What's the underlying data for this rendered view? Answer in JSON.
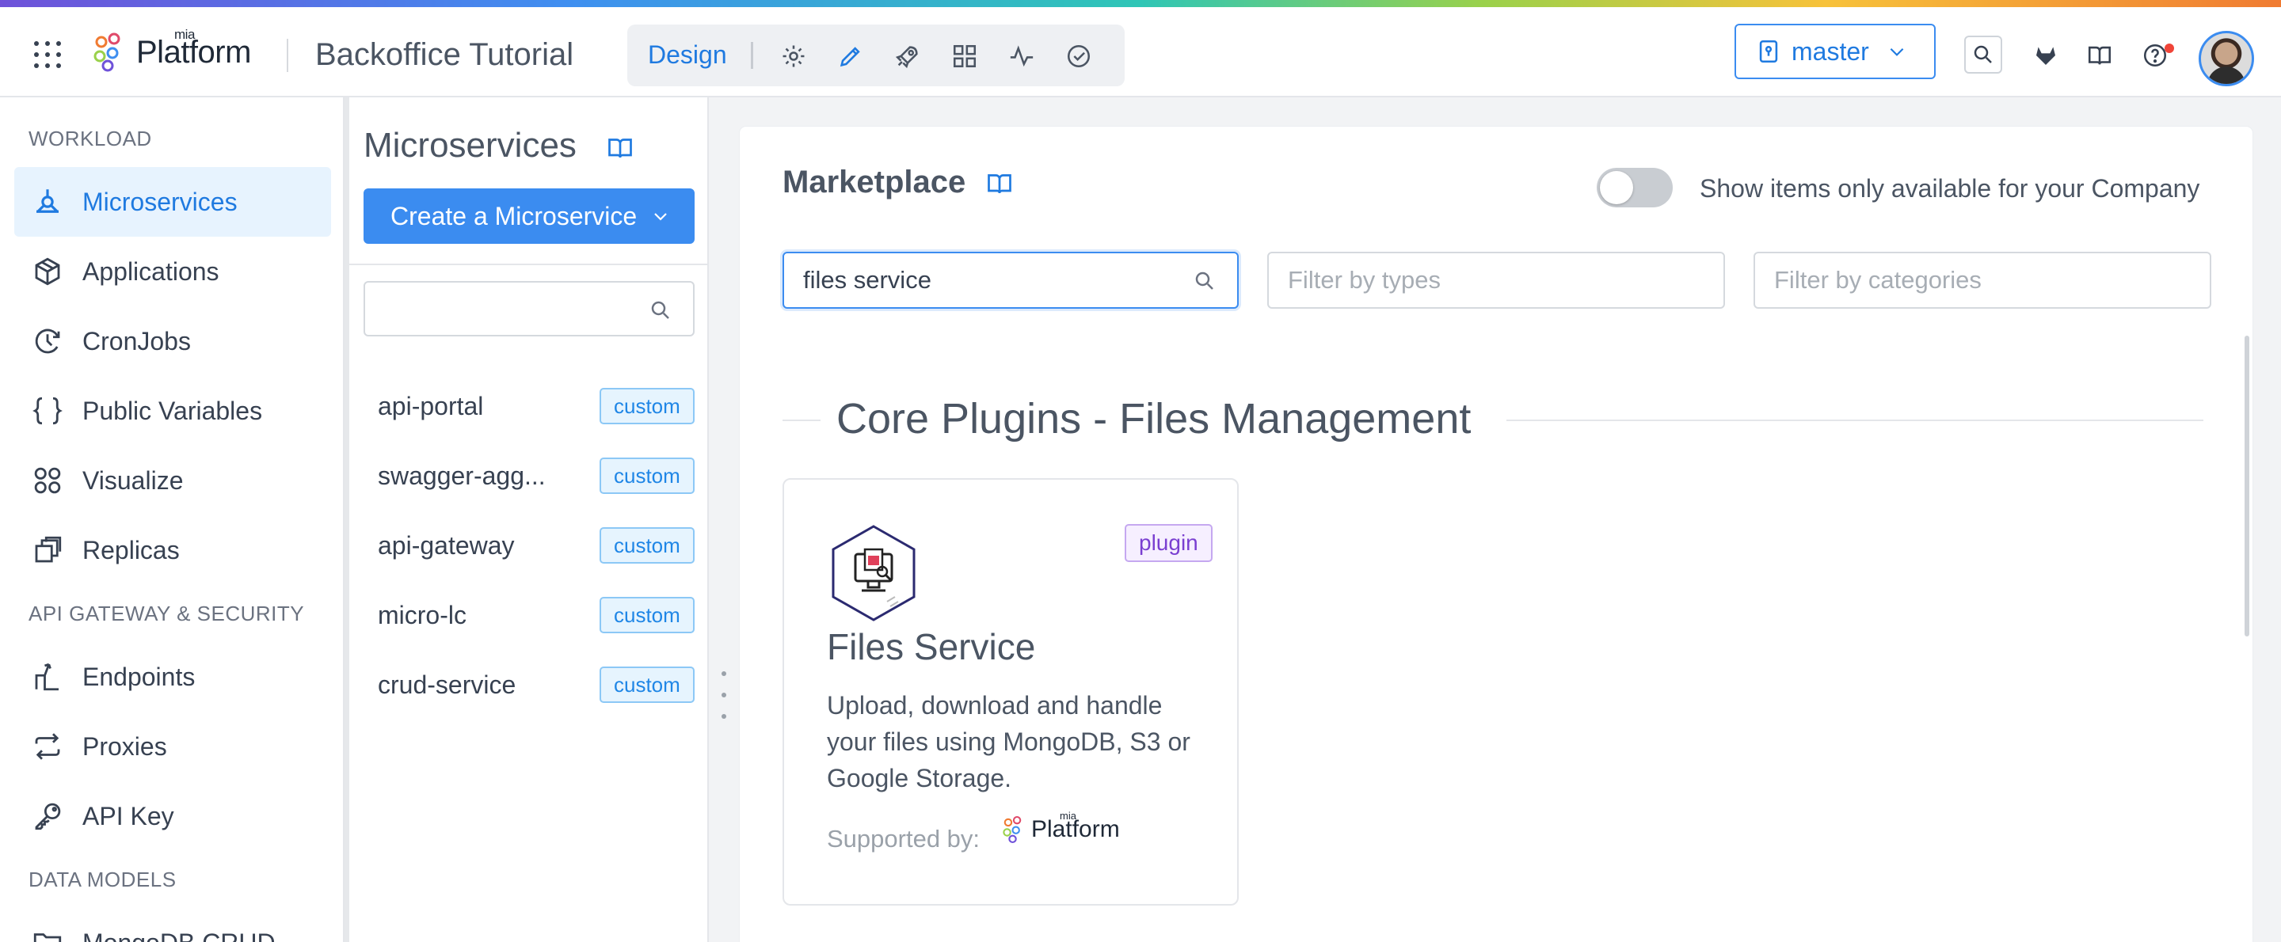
{
  "app": {
    "brand_prefix": "mia",
    "brand_name": "Platform",
    "project_title": "Backoffice Tutorial",
    "mode": "Design",
    "branch": "master",
    "accent_color": "#3b8cf0"
  },
  "sidebar": {
    "sections": [
      {
        "title": "WORKLOAD"
      },
      {
        "title": "API GATEWAY & SECURITY"
      },
      {
        "title": "DATA MODELS"
      }
    ],
    "items": [
      {
        "label": "Microservices",
        "icon": "microservices-icon",
        "active": true
      },
      {
        "label": "Applications",
        "icon": "cube-icon"
      },
      {
        "label": "CronJobs",
        "icon": "clock-icon"
      },
      {
        "label": "Public Variables",
        "icon": "braces-icon"
      },
      {
        "label": "Visualize",
        "icon": "graph-icon"
      },
      {
        "label": "Replicas",
        "icon": "copy-icon"
      },
      {
        "label": "Endpoints",
        "icon": "endpoint-icon"
      },
      {
        "label": "Proxies",
        "icon": "swap-icon"
      },
      {
        "label": "API Key",
        "icon": "key-icon"
      },
      {
        "label": "MongoDB CRUD",
        "icon": "folder-icon"
      }
    ]
  },
  "microservices": {
    "title": "Microservices",
    "create_label": "Create a Microservice",
    "search_value": "",
    "list": [
      {
        "name": "api-portal",
        "tag": "custom"
      },
      {
        "name": "swagger-agg...",
        "tag": "custom"
      },
      {
        "name": "api-gateway",
        "tag": "custom"
      },
      {
        "name": "micro-lc",
        "tag": "custom"
      },
      {
        "name": "crud-service",
        "tag": "custom"
      }
    ]
  },
  "marketplace": {
    "title": "Marketplace",
    "toggle_label": "Show items only available for your Company",
    "toggle_on": false,
    "search_value": "files service",
    "types_placeholder": "Filter by types",
    "categories_placeholder": "Filter by categories",
    "group_title": "Core Plugins - Files Management",
    "card": {
      "badge": "plugin",
      "title": "Files Service",
      "description": "Upload, download and handle your files using MongoDB, S3 or Google Storage.",
      "supported_label": "Supported by:",
      "supporter_prefix": "mia",
      "supporter_name": "Platform"
    }
  }
}
